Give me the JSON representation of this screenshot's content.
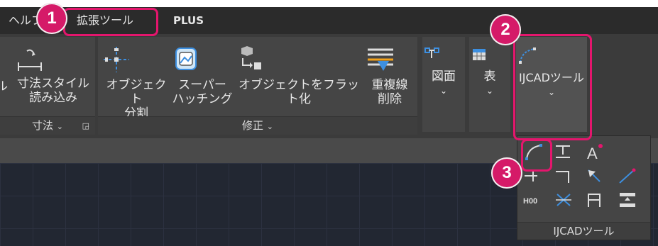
{
  "tabs": [
    {
      "label": "ヘルプ"
    },
    {
      "label": "拡張ツール"
    },
    {
      "label": "PLUS"
    }
  ],
  "ribbon": {
    "partial_left_label": "ル",
    "dim_style_button": {
      "label_line1": "寸法スタイル",
      "label_line2": "読み込み"
    },
    "dim_panel_footer": "寸法",
    "split_button": {
      "label_line1": "オブジェクト",
      "label_line2": "分割"
    },
    "super_hatch_button": {
      "label_line1": "スーパー",
      "label_line2": "ハッチング"
    },
    "flatten_button": {
      "label": "オブジェクトをフラット化"
    },
    "overkill_button": {
      "label_line1": "重複線",
      "label_line2": "削除"
    },
    "modify_panel_footer": "修正",
    "drawing_button": {
      "label": "図面",
      "chevron": "⌄"
    },
    "table_button": {
      "label": "表",
      "chevron": "⌄"
    },
    "ijcad_tools_button": {
      "label": "IJCADツール",
      "chevron": "⌄"
    }
  },
  "popup": {
    "footer": "IJCADツール",
    "tool_icons": [
      "arc-tool-icon",
      "align-tool-icon",
      "text-a-icon",
      "extend-icon",
      "corner-icon",
      "pointer-arrow-icon",
      "line-tool-icon",
      "h00-icon",
      "cross-icon",
      "table-frame-icon",
      "stack-icon"
    ],
    "h00_text": "H00"
  },
  "annotations": [
    "1",
    "2",
    "3"
  ],
  "colors": {
    "accent": "#e4166d",
    "badge": "#d51a68",
    "ribbon_bg": "#3b3b3b",
    "panel_bg": "#454545",
    "canvas_bg": "#222732",
    "icon_blue": "#3d8fe0"
  }
}
